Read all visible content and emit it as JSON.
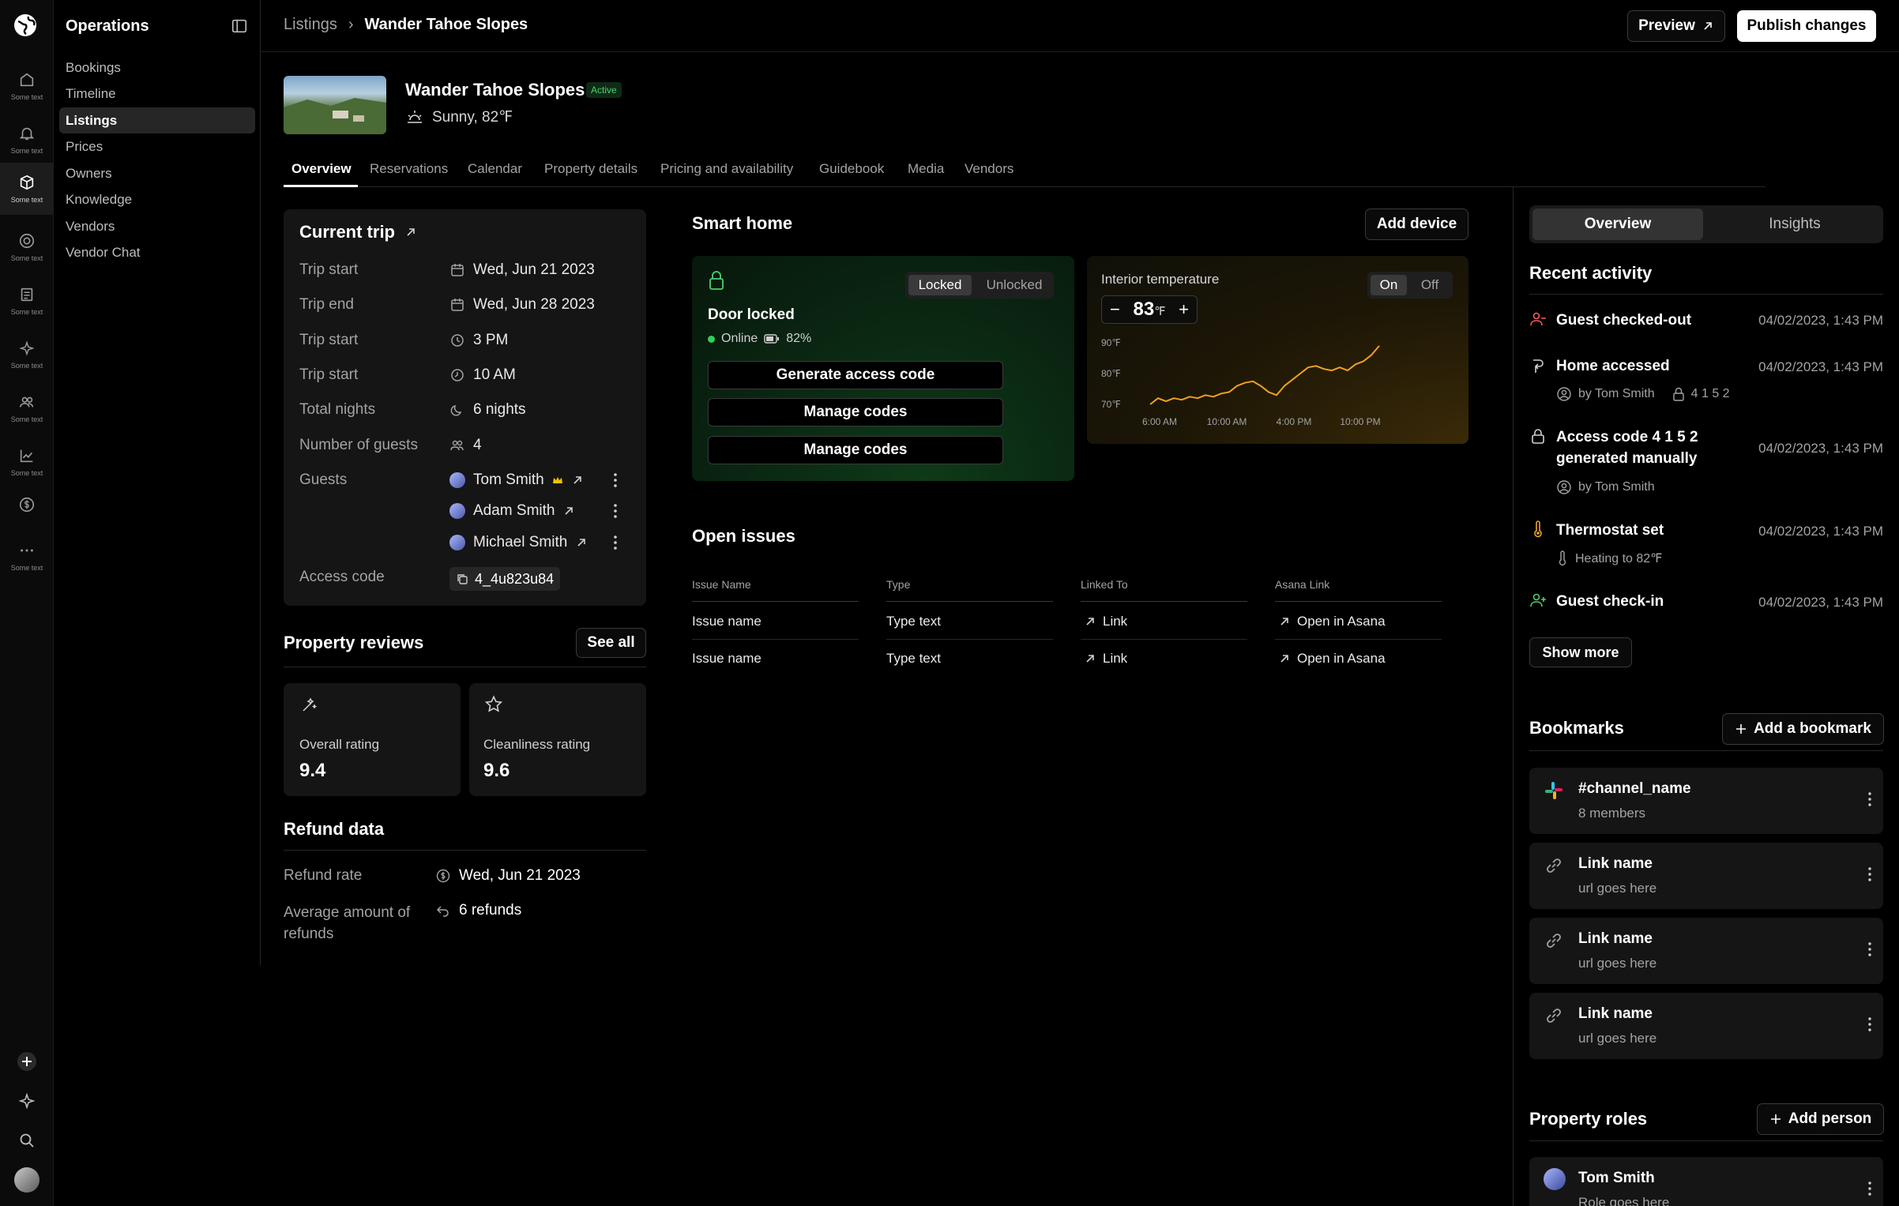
{
  "rail": {
    "items": [
      {
        "icon": "home-icon",
        "label": "Some text"
      },
      {
        "icon": "bell-icon",
        "label": "Some text"
      },
      {
        "icon": "box-icon",
        "label": "Some text"
      },
      {
        "icon": "lifebuoy-icon",
        "label": "Some text"
      },
      {
        "icon": "document-icon",
        "label": "Some text"
      },
      {
        "icon": "sparkle-icon",
        "label": "Some text"
      },
      {
        "icon": "users-icon",
        "label": "Some text"
      },
      {
        "icon": "chart-icon",
        "label": "Some text"
      },
      {
        "icon": "dollar-icon",
        "label": ""
      },
      {
        "icon": "more-icon",
        "label": "Some text"
      }
    ]
  },
  "nav": {
    "title": "Operations",
    "items": [
      "Bookings",
      "Timeline",
      "Listings",
      "Prices",
      "Owners",
      "Knowledge",
      "Vendors",
      "Vendor Chat"
    ]
  },
  "header": {
    "breadcrumb_root": "Listings",
    "breadcrumb_current": "Wander Tahoe Slopes",
    "preview_label": "Preview",
    "publish_label": "Publish changes"
  },
  "property": {
    "name": "Wander Tahoe Slopes",
    "status": "Active",
    "weather": "Sunny, 82℉"
  },
  "tabs": [
    "Overview",
    "Reservations",
    "Calendar",
    "Property details",
    "Pricing and availability",
    "Guidebook",
    "Media",
    "Vendors"
  ],
  "trip": {
    "title": "Current trip",
    "rows": [
      {
        "label": "Trip start",
        "value": "Wed, Jun 21 2023",
        "icon": "calendar-icon"
      },
      {
        "label": "Trip end",
        "value": "Wed, Jun 28 2023",
        "icon": "calendar-icon"
      },
      {
        "label": "Trip start",
        "value": "3 PM",
        "icon": "clock-icon"
      },
      {
        "label": "Trip start",
        "value": "10 AM",
        "icon": "clock-icon"
      },
      {
        "label": "Total nights",
        "value": "6 nights",
        "icon": "moon-icon"
      },
      {
        "label": "Number of guests",
        "value": "4",
        "icon": "users-icon"
      }
    ],
    "guests_label": "Guests",
    "guests": [
      "Tom Smith",
      "Adam Smith",
      "Michael Smith"
    ],
    "access_label": "Access code",
    "access_code": "4_4u823u84"
  },
  "reviews": {
    "title": "Property reviews",
    "see_all": "See all",
    "overall_label": "Overall rating",
    "overall_value": "9.4",
    "clean_label": "Cleanliness rating",
    "clean_value": "9.6"
  },
  "refund": {
    "title": "Refund data",
    "rate_label": "Refund rate",
    "rate_value": "Wed, Jun 21 2023",
    "avg_label": "Average amount of refunds",
    "avg_value": "6 refunds"
  },
  "smart_home": {
    "title": "Smart home",
    "add_device": "Add device",
    "lock_seg": [
      "Locked",
      "Unlocked"
    ],
    "door_status": "Door locked",
    "online": "Online",
    "battery": "82%",
    "buttons": [
      "Generate access code",
      "Manage codes",
      "Manage codes"
    ],
    "temp_title": "Interior temperature",
    "temp_value": "83",
    "temp_unit": "℉",
    "temp_seg": [
      "On",
      "Off"
    ],
    "colors": {
      "lock_bg": "#0b2a12",
      "temp_line": "#f0a020"
    }
  },
  "chart_data": {
    "type": "line",
    "title": "Interior temperature",
    "x_ticks": [
      "6:00 AM",
      "10:00 AM",
      "4:00 PM",
      "10:00 PM"
    ],
    "y_ticks": [
      "90℉",
      "80℉",
      "70℉"
    ],
    "ylim": [
      70,
      90
    ],
    "values": [
      70,
      72,
      71,
      72,
      71.5,
      72.5,
      72,
      73,
      72.5,
      73.5,
      74,
      76,
      77,
      77.5,
      76,
      74,
      73,
      76,
      78,
      80,
      82,
      82.5,
      81.5,
      81,
      82,
      81,
      83,
      84,
      86,
      89
    ],
    "grid": false,
    "legend": "none"
  },
  "issues": {
    "title": "Open issues",
    "columns": [
      "Issue Name",
      "Type",
      "Linked To",
      "Asana Link"
    ],
    "rows": [
      {
        "name": "Issue name",
        "type": "Type text",
        "link": "Link",
        "asana": "Open in Asana"
      },
      {
        "name": "Issue name",
        "type": "Type text",
        "link": "Link",
        "asana": "Open in Asana"
      }
    ]
  },
  "right": {
    "seg": [
      "Overview",
      "Insights"
    ],
    "activity_title": "Recent activity",
    "activity": [
      {
        "title": "Guest checked-out",
        "time": "04/02/2023, 1:43 PM"
      },
      {
        "title": "Home accessed",
        "time": "04/02/2023, 1:43 PM",
        "sub_by": "by Tom Smith",
        "sub_code": "4 1 5 2"
      },
      {
        "title": "Access code 4 1 5 2",
        "title2": "generated manually",
        "time": "04/02/2023, 1:43 PM",
        "sub_by": "by Tom Smith"
      },
      {
        "title": "Thermostat set",
        "time": "04/02/2023, 1:43 PM",
        "sub": "Heating to 82℉"
      },
      {
        "title": "Guest check-in",
        "time": "04/02/2023, 1:43 PM"
      }
    ],
    "show_more": "Show more",
    "bookmarks_title": "Bookmarks",
    "add_bookmark": "Add a bookmark",
    "bookmarks": [
      {
        "title": "#channel_name",
        "sub": "8 members",
        "icon": "slack-icon"
      },
      {
        "title": "Link name",
        "sub": "url goes here",
        "icon": "link-icon"
      },
      {
        "title": "Link name",
        "sub": "url goes here",
        "icon": "link-icon"
      },
      {
        "title": "Link name",
        "sub": "url goes here",
        "icon": "link-icon"
      }
    ],
    "roles_title": "Property roles",
    "add_person": "Add person",
    "role_person": "Tom Smith",
    "role_sub": "Role goes here"
  }
}
